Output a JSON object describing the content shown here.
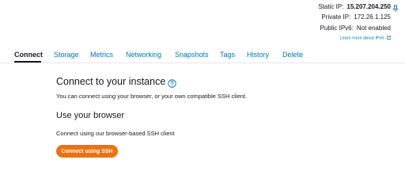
{
  "instance_info": {
    "static_ip_label": "Static IP:",
    "static_ip_value": "15.207.204.250",
    "private_ip_label": "Private IP:",
    "private_ip_value": "172.26.1.125",
    "public_ipv6_label": "Public IPv6:",
    "public_ipv6_value": "Not enabled",
    "learn_more_link": "Learn more about IPv6"
  },
  "tabs": [
    {
      "label": "Connect",
      "active": true
    },
    {
      "label": "Storage"
    },
    {
      "label": "Metrics"
    },
    {
      "label": "Networking"
    },
    {
      "label": "Snapshots"
    },
    {
      "label": "Tags"
    },
    {
      "label": "History"
    },
    {
      "label": "Delete"
    }
  ],
  "main": {
    "title": "Connect to your instance",
    "subtitle": "You can connect using your browser, or your own compatible SSH client.",
    "browser_section_title": "Use your browser",
    "browser_section_desc": "Connect using our browser-based SSH client",
    "connect_button_label": "Connect using SSH"
  },
  "colors": {
    "link": "#0073bb",
    "primary_button": "#ec7211",
    "text": "#16191f"
  },
  "icons": [
    "pin-icon",
    "external-link-icon",
    "help-icon"
  ]
}
